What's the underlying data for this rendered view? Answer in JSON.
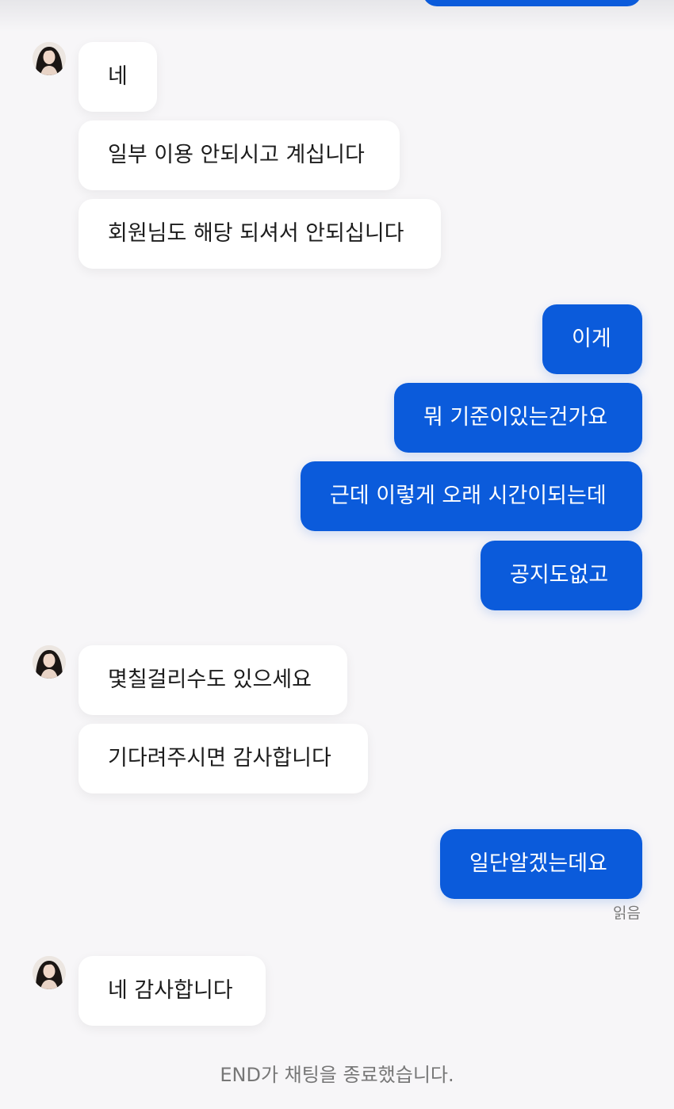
{
  "colors": {
    "background": "#f7f6f8",
    "incoming_bubble": "#ffffff",
    "outgoing_bubble": "#0b5bdb",
    "outgoing_text": "#ffffff",
    "incoming_text": "#1c1c1c",
    "meta_text": "#777777"
  },
  "messages": {
    "m1": "네",
    "m2": "일부 이용 안되시고 계십니다",
    "m3": "회원님도 해당 되셔서 안되십니다",
    "m4": "이게",
    "m5": "뭐 기준이있는건가요",
    "m6": "근데 이렇게 오래 시간이되는데",
    "m7": "공지도없고",
    "m8": "몇칠걸리수도 있으세요",
    "m9": "기다려주시면 감사합니다",
    "m10": "일단알겠는데요",
    "m11": "네 감사합니다"
  },
  "read_status": "읽음",
  "system_message": "END가 채팅을 종료했습니다."
}
